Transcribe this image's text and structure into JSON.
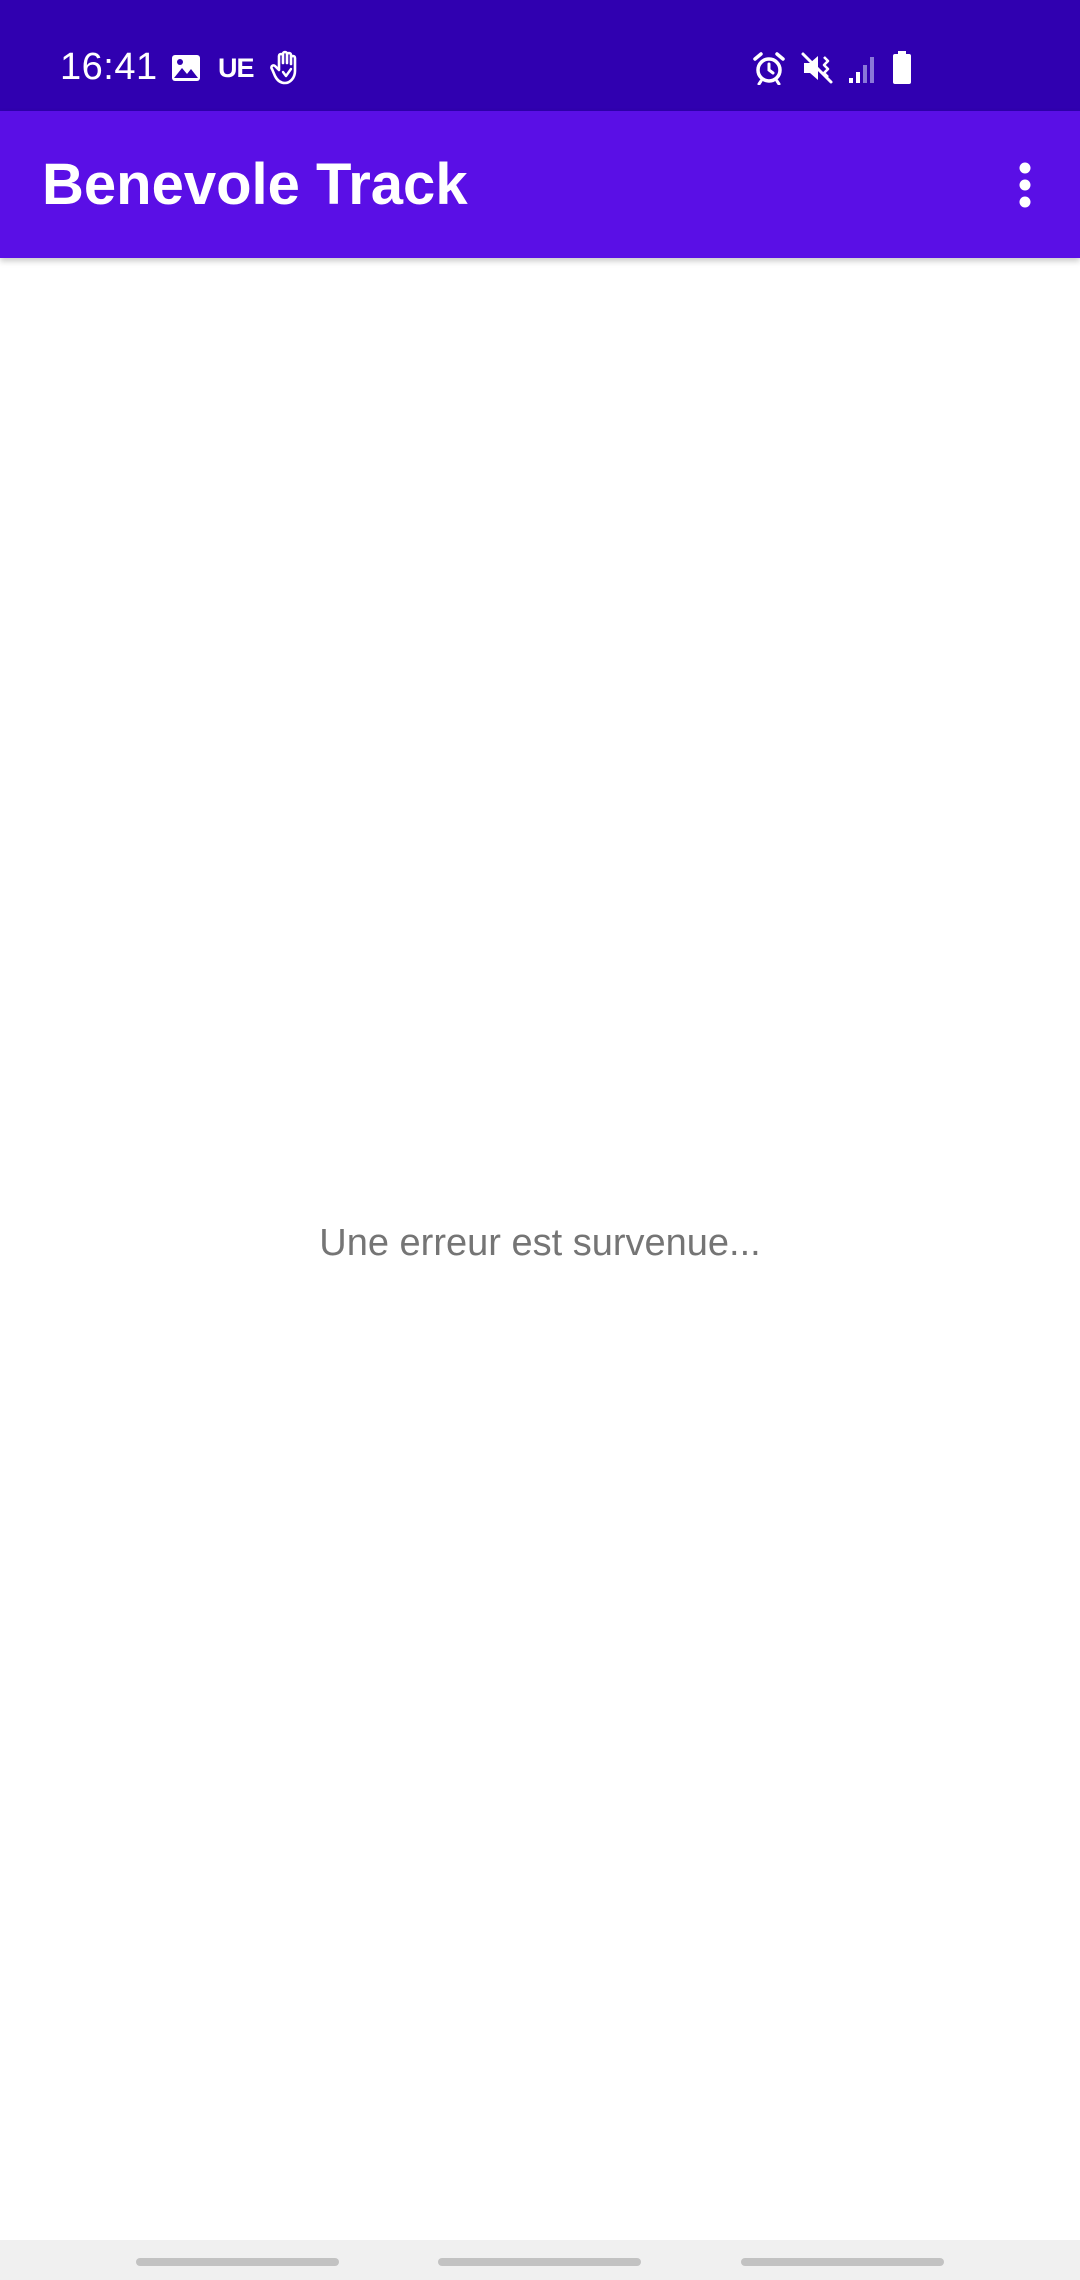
{
  "status_bar": {
    "time": "16:41",
    "ue_label": "UE",
    "background_color": "#3000b0",
    "left_icons": [
      "gallery-icon",
      "ue-notification-icon",
      "hand-gesture-icon"
    ],
    "right_icons": [
      "alarm-icon",
      "mute-vibrate-icon",
      "signal-icon",
      "battery-icon"
    ]
  },
  "app_bar": {
    "title": "Benevole Track",
    "background_color": "#5a0fe6",
    "overflow_icon": "more-vertical-icon"
  },
  "main": {
    "error_message": "Une erreur est survenue..."
  },
  "nav_bar": {
    "handles": [
      "recent-apps",
      "home",
      "back"
    ]
  }
}
